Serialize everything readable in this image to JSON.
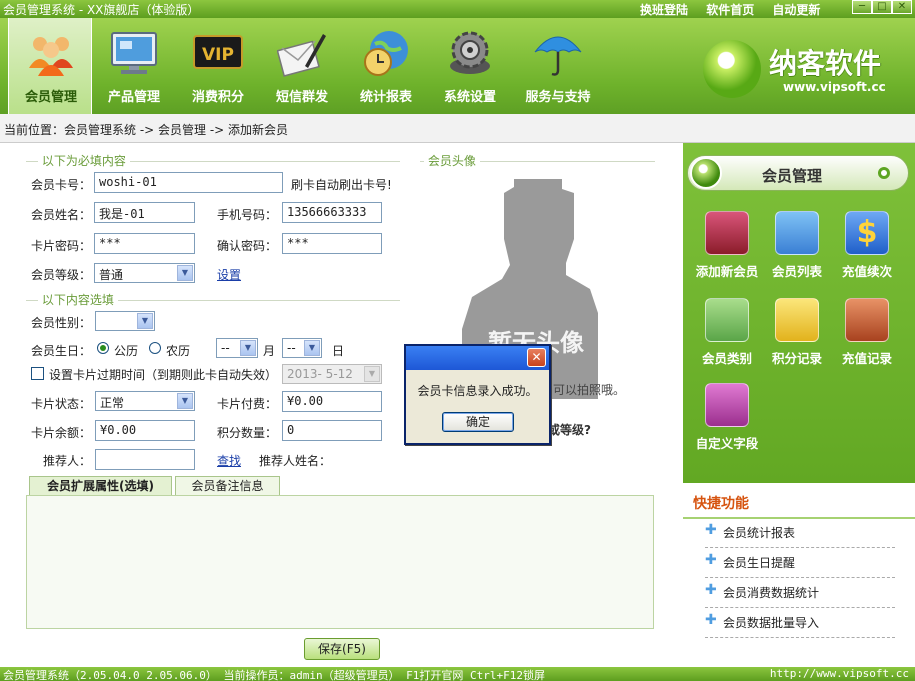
{
  "window": {
    "title": "会员管理系统 - XX旗舰店（体验版）",
    "top_links": [
      "换班登陆",
      "软件首页",
      "自动更新"
    ],
    "controls": [
      "─",
      "□",
      "✕"
    ]
  },
  "toolbar": {
    "items": [
      {
        "label": "会员管理",
        "icon": "members-icon",
        "active": true
      },
      {
        "label": "产品管理",
        "icon": "monitor-icon"
      },
      {
        "label": "消费积分",
        "icon": "vip-card-icon"
      },
      {
        "label": "短信群发",
        "icon": "envelope-pen-icon"
      },
      {
        "label": "统计报表",
        "icon": "globe-clock-icon"
      },
      {
        "label": "系统设置",
        "icon": "gear-icon"
      },
      {
        "label": "服务与支持",
        "icon": "umbrella-icon"
      }
    ]
  },
  "logo": {
    "brand": "纳客软件",
    "url": "www.vipsoft.cc"
  },
  "breadcrumb": "当前位置：会员管理系统 -> 会员管理 -> 添加新会员",
  "form": {
    "required_section": "以下为必填内容",
    "optional_section": "以下内容选填",
    "avatar_section": "会员头像",
    "card_no_label": "会员卡号：",
    "card_no_value": "woshi-01",
    "swipe_hint": "刷卡自动刷出卡号!",
    "name_label": "会员姓名：",
    "name_value": "我是-01",
    "phone_label": "手机号码：",
    "phone_value": "13566663333",
    "pwd_label": "卡片密码：",
    "pwd_value": "***",
    "confirm_label": "确认密码：",
    "confirm_value": "***",
    "level_label": "会员等级：",
    "level_value": "普通",
    "settings_link": "设置",
    "gender_label": "会员性别：",
    "gender_value": "",
    "birthday_label": "会员生日：",
    "solar_label": "公历",
    "lunar_label": "农历",
    "month_value": "--",
    "month_label": "月",
    "day_value": "--",
    "day_label": "日",
    "expiry_label": "设置卡片过期时间（到期则此卡自动失效）",
    "expiry_value": "2013- 5-12",
    "status_label": "卡片状态：",
    "status_value": "正常",
    "fee_label": "卡片付费：",
    "fee_value": "¥0.00",
    "balance_label": "卡片余额：",
    "balance_value": "¥0.00",
    "points_label": "积分数量：",
    "points_value": "0",
    "referrer_label": "推荐人：",
    "referrer_value": "",
    "find_link": "查找",
    "referrer_name_label": "推荐人姓名：",
    "photo_hint": "可以拍照哦。",
    "grade_hint": "或等级?",
    "avatar_text": "暂无头像",
    "tabs": [
      "会员扩展属性(选填)",
      "会员备注信息"
    ],
    "save_label": "保存(F5)"
  },
  "dialog": {
    "message": "会员卡信息录入成功。",
    "ok_label": "确定",
    "close": "✕"
  },
  "right_panel": {
    "header": "会员管理",
    "items": [
      {
        "label": "添加新会员",
        "icon": "add-member-icon",
        "color": "#8b1c2a"
      },
      {
        "label": "会员列表",
        "icon": "member-list-icon",
        "color": "#3a7fd4"
      },
      {
        "label": "充值续次",
        "icon": "dollar-icon",
        "color": "#1f5fc9"
      },
      {
        "label": "会员类别",
        "icon": "member-category-icon",
        "color": "#5aa548"
      },
      {
        "label": "积分记录",
        "icon": "points-record-icon",
        "color": "#e2b21c"
      },
      {
        "label": "充值记录",
        "icon": "recharge-record-icon",
        "color": "#a8421f"
      },
      {
        "label": "自定义字段",
        "icon": "custom-field-icon",
        "color": "#9b2f8e"
      }
    ],
    "quick_title": "快捷功能",
    "quick_links": [
      "会员统计报表",
      "会员生日提醒",
      "会员消费数据统计",
      "会员数据批量导入"
    ]
  },
  "statusbar": {
    "left": "会员管理系统（2.05.04.0 2.05.06.0） 当前操作员：admin（超级管理员） F1打开官网 Ctrl+F12锁屏",
    "right": "http://www.vipsoft.cc"
  }
}
